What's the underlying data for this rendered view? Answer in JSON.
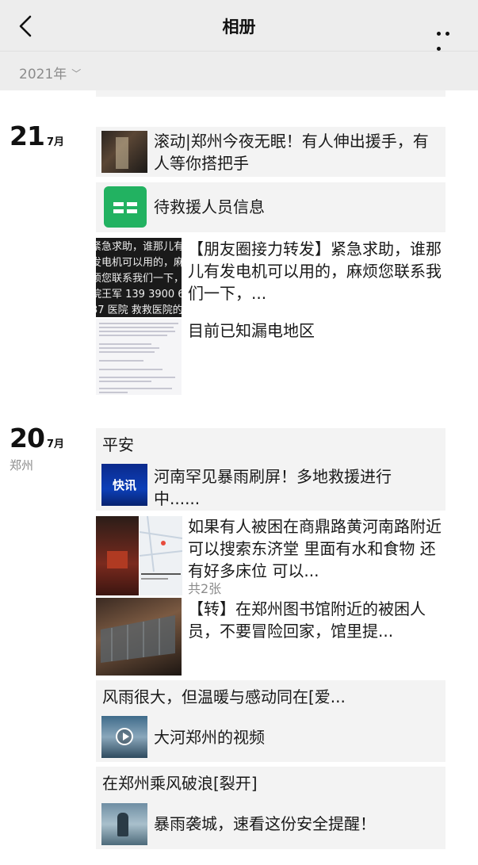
{
  "nav": {
    "title": "相册"
  },
  "year_selector": {
    "label": "2021年"
  },
  "entries": [
    {
      "day": "21",
      "month": "7月",
      "items": [
        {
          "text": "滚动|郑州今夜无眠！有人伸出援手，有人等你搭把手"
        },
        {
          "text": "待救援人员信息"
        },
        {
          "text": "【朋友圈接力转发】紧急求助，谁那儿有发电机可以用的，麻烦您联系我们一下，..."
        },
        {
          "text": "目前已知漏电地区"
        }
      ],
      "photo_caption_1": "紧急求助，谁那儿有发电机可以用的，麻烦您联系我们一下，院王军 139 3900 637 医院 救救医院的重症"
    },
    {
      "day": "20",
      "month": "7月",
      "location": "郑州",
      "items": [
        {
          "title": "平安",
          "text": "河南罕见暴雨刷屏！多地救援进行中......"
        },
        {
          "text": "如果有人被困在商鼎路黄河南路附近 可以搜索东济堂 里面有水和食物 还有好多床位 可以...",
          "count": "共2张"
        },
        {
          "text": "【转】在郑州图书馆附近的被困人员，不要冒险回家，馆里提..."
        },
        {
          "title": "风雨很大，但温暖与感动同在[爱...",
          "text": "大河郑州的视频"
        },
        {
          "title": "在郑州乘风破浪[裂开]",
          "text": "暴雨袭城，速看这份安全提醒！"
        }
      ],
      "badge_kuaixun": "快讯"
    }
  ]
}
